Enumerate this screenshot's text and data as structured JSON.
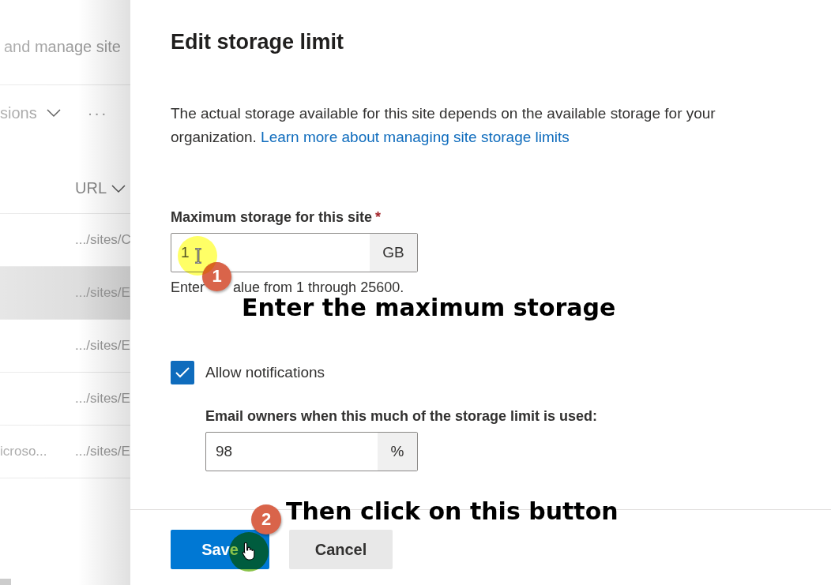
{
  "background_page": {
    "header_text": "and manage site",
    "toolbar_label": "sions",
    "more": "···",
    "columns": [
      {
        "label": "URL"
      }
    ],
    "rows": [
      {
        "url": ".../sites/C",
        "selected": false
      },
      {
        "url": ".../sites/E",
        "selected": true
      },
      {
        "url": ".../sites/E",
        "selected": false
      },
      {
        "url": ".../sites/E",
        "selected": false
      },
      {
        "name": "icroso...",
        "url": ".../sites/E",
        "selected": false
      }
    ]
  },
  "panel": {
    "title": "Edit storage limit",
    "description": "The actual storage available for this site depends on the available storage for your organization.",
    "link": "Learn more about managing site storage limits",
    "storage_field": {
      "label": "Maximum storage for this site",
      "required_mark": "*",
      "value": "1",
      "unit": "GB",
      "help_before": "Enter",
      "help_after": "alue from 1 through 25600."
    },
    "notifications": {
      "label": "Allow notifications",
      "checked": true
    },
    "email_field": {
      "label": "Email owners when this much of the storage limit is used:",
      "value": "98",
      "unit": "%"
    },
    "buttons": [
      {
        "label": "Save",
        "kind": "primary"
      },
      {
        "label": "Cancel",
        "kind": "secondary"
      }
    ]
  },
  "callouts": [
    {
      "number": "1",
      "text": "Enter the maximum storage"
    },
    {
      "number": "2",
      "text": "Then click on this button"
    }
  ],
  "cursor_marks": [
    {
      "kind": "text",
      "color": "#ffff66"
    },
    {
      "kind": "pointer",
      "color": "#8bc34a"
    }
  ]
}
